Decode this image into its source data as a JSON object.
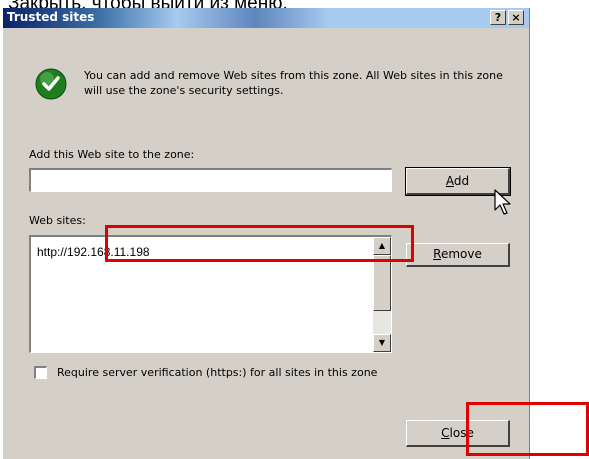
{
  "page_caption": "Закрыть, чтобы выйти из меню.",
  "dialog": {
    "title": "Trusted sites",
    "help_button": "?",
    "close_x_button": "×",
    "description": "You can add and remove Web sites from this zone. All Web sites in this zone will use the zone's security settings.",
    "add_label": "Add this Web site to the zone:",
    "add_input_value": "",
    "add_button": {
      "pre": "",
      "accel": "A",
      "post": "dd"
    },
    "websites_label": "Web sites:",
    "websites": [
      "http://192.168.11.198"
    ],
    "remove_button": {
      "pre": "",
      "accel": "R",
      "post": "emove"
    },
    "require_https_label": "Require server verification (https:) for all sites in this zone",
    "require_https_checked": false,
    "close_button": {
      "pre": "",
      "accel": "C",
      "post": "lose"
    }
  },
  "annotations": {
    "highlight_color": "#e00000"
  },
  "icons": {
    "info": "check-icon",
    "cursor": "mouse-pointer-icon"
  }
}
